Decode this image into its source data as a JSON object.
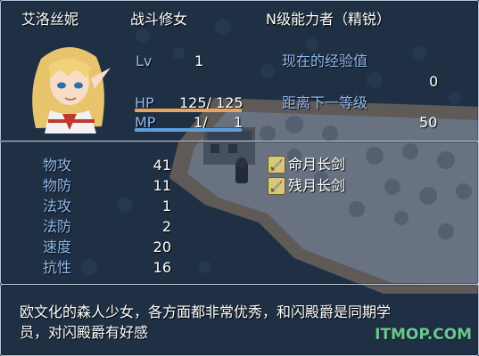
{
  "header": {
    "name": "艾洛丝妮",
    "class": "战斗修女",
    "nickname": "N级能力者（精锐）"
  },
  "status": {
    "lv_label": "Lv",
    "lv_value": "1",
    "hp_label": "HP",
    "hp_value": "125/ 125",
    "mp_label": "MP",
    "mp_current": "1/",
    "mp_max": "1",
    "exp_label": "现在的经验值",
    "exp_value": "0",
    "next_label": "距离下一等级",
    "next_value": "50",
    "hp_fill": 1.0,
    "mp_fill": 1.0,
    "hp_color": "#e8a45c",
    "mp_color": "#5aa0e0"
  },
  "params": [
    {
      "label": "物攻",
      "value": "41"
    },
    {
      "label": "物防",
      "value": "11"
    },
    {
      "label": "法攻",
      "value": "1"
    },
    {
      "label": "法防",
      "value": "2"
    },
    {
      "label": "速度",
      "value": "20"
    },
    {
      "label": "抗性",
      "value": "16"
    }
  ],
  "equipment": [
    {
      "icon": "sword-icon",
      "name": "命月长剑"
    },
    {
      "icon": "sword-icon",
      "name": "残月长剑"
    }
  ],
  "description": {
    "line1": "欧文化的森人少女，各方面都非常优秀，和闪殿爵是同期学",
    "line2": "员，对闪殿爵有好感"
  },
  "watermark": "ITMOP.COM"
}
